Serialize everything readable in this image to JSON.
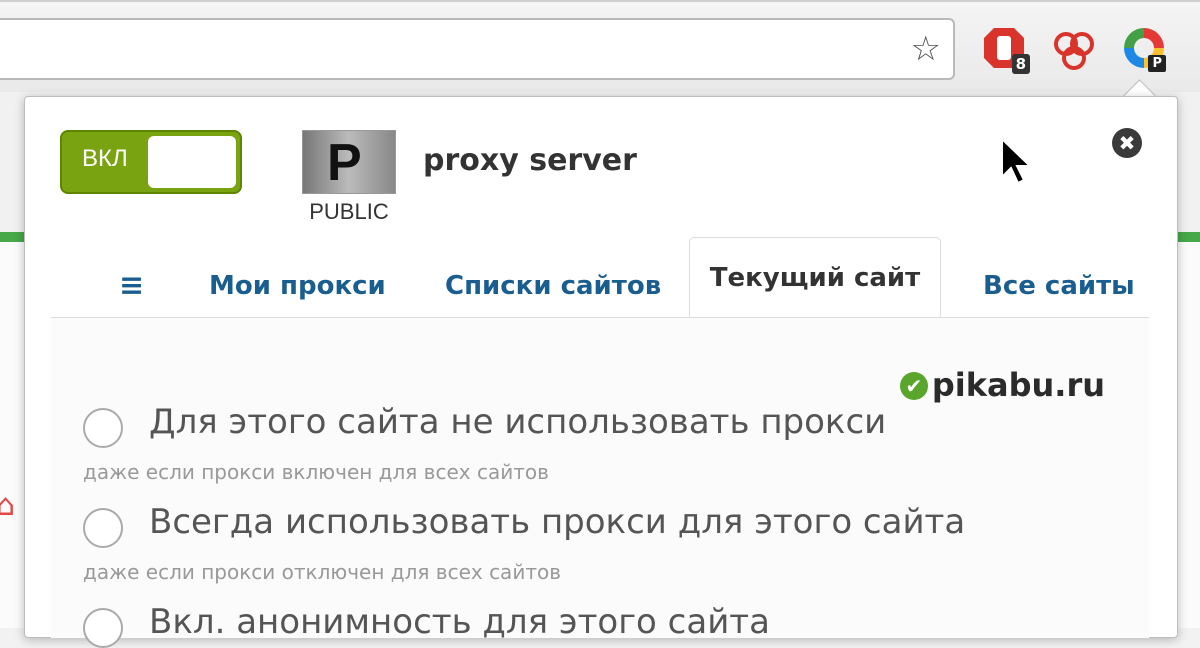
{
  "browser": {
    "star_icon": "star-icon",
    "extensions": [
      {
        "name": "stop-extension-icon",
        "badge": "8",
        "color": "#d9342b"
      },
      {
        "name": "hearts-extension-icon",
        "badge": "",
        "color": "#d9342b"
      },
      {
        "name": "proxy-extension-icon",
        "badge": "P",
        "color": "#1e88e5"
      }
    ],
    "page_side_icon": "⌂"
  },
  "popup": {
    "toggle_label": "ВКЛ",
    "logo_letter": "P",
    "logo_sub": "PUBLIC",
    "proxy_name": "proxy server",
    "close_icon": "✖",
    "tabs": [
      {
        "label": "≡"
      },
      {
        "label": "Мои прокси"
      },
      {
        "label": "Списки сайтов"
      },
      {
        "label": "Текущий сайт"
      },
      {
        "label": "Все сайты"
      }
    ],
    "site": "pikabu.ru",
    "site_check": "✔",
    "options": [
      {
        "label": "Для этого сайта не использовать прокси",
        "hint": "даже если прокси включен для всех сайтов"
      },
      {
        "label": "Всегда использовать прокси для этого сайта",
        "hint": "даже если прокси отключен для всех сайтов"
      },
      {
        "label": "Вкл. анонимность для этого сайта",
        "hint": ""
      }
    ]
  },
  "colors": {
    "toggle_on": "#7aa312",
    "tab_link": "#1a5e8f",
    "accent_green": "#46a848"
  }
}
